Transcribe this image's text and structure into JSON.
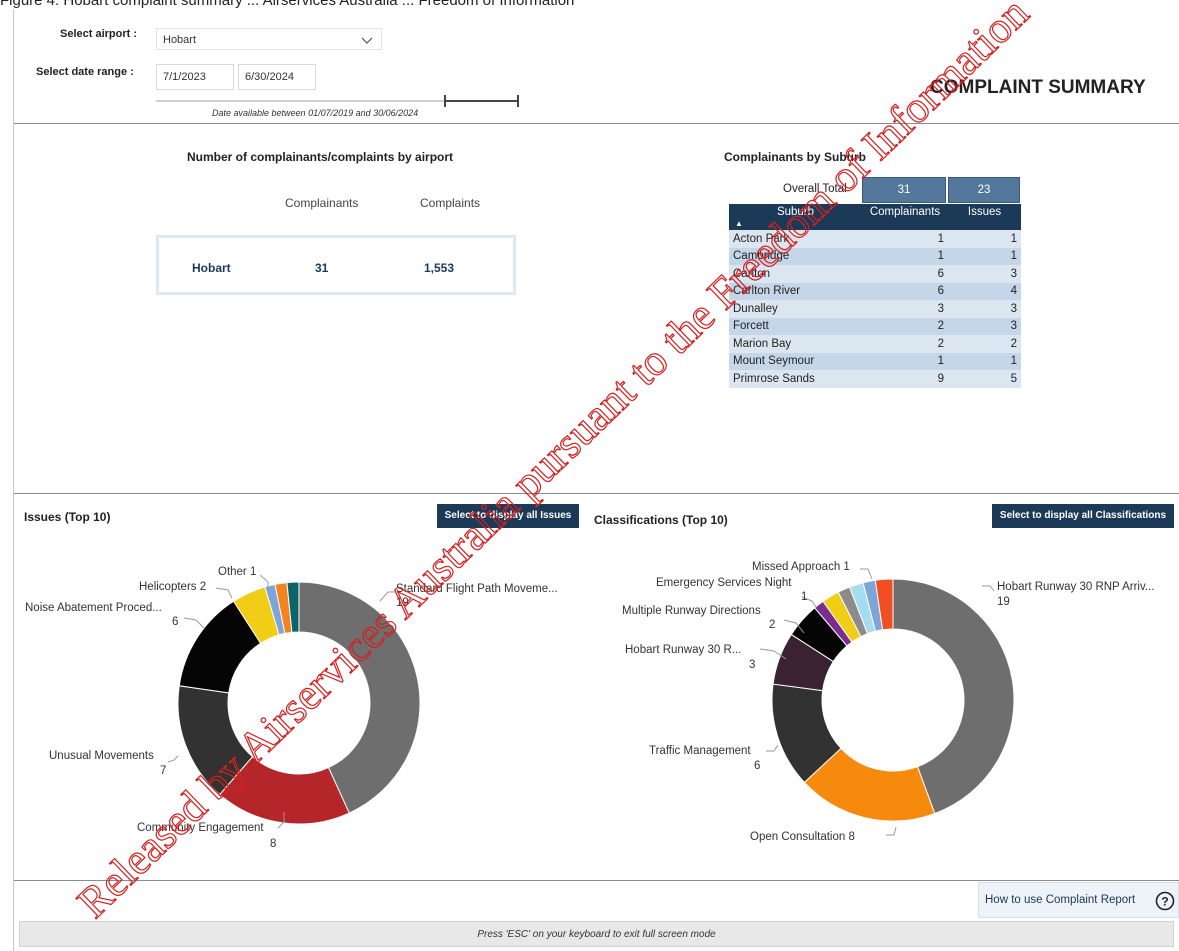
{
  "page_caption": "Figure 4: Hobart complaint summary ... Airservices Australia ... Freedom of Information",
  "filters": {
    "airport_label": "Select airport :",
    "airport_value": "Hobart",
    "date_label": "Select date range :",
    "date_start": "7/1/2023",
    "date_end": "6/30/2024",
    "date_note": "Date available between 01/07/2019 and 30/06/2024"
  },
  "report_title": "COMPLAINT SUMMARY",
  "by_airport": {
    "title": "Number of complainants/complaints by airport",
    "headers": [
      "Complainants",
      "Complaints"
    ],
    "rows": [
      {
        "airport": "Hobart",
        "complainants": "31",
        "complaints": "1,553"
      }
    ]
  },
  "by_suburb": {
    "title": "Complainants by Suburb",
    "overall_label": "Overall Total",
    "overall_complainants": "31",
    "overall_issues": "23",
    "headers": [
      "Suburb",
      "Complainants",
      "Issues"
    ],
    "rows": [
      {
        "suburb": "Acton Park",
        "complainants": "1",
        "issues": "1"
      },
      {
        "suburb": "Cambridge",
        "complainants": "1",
        "issues": "1"
      },
      {
        "suburb": "Carlton",
        "complainants": "6",
        "issues": "3"
      },
      {
        "suburb": "Carlton River",
        "complainants": "6",
        "issues": "4"
      },
      {
        "suburb": "Dunalley",
        "complainants": "3",
        "issues": "3"
      },
      {
        "suburb": "Forcett",
        "complainants": "2",
        "issues": "3"
      },
      {
        "suburb": "Marion Bay",
        "complainants": "2",
        "issues": "2"
      },
      {
        "suburb": "Mount Seymour",
        "complainants": "1",
        "issues": "1"
      },
      {
        "suburb": "Primrose Sands",
        "complainants": "9",
        "issues": "5"
      }
    ]
  },
  "issues_panel": {
    "title": "Issues (Top 10)",
    "button": "Select to display all Issues"
  },
  "class_panel": {
    "title": "Classifications (Top 10)",
    "button": "Select to display all Classifications"
  },
  "chart_data": [
    {
      "type": "pie",
      "title": "Issues (Top 10)",
      "slices": [
        {
          "label": "Standard Flight Path Moveme...",
          "value": 19,
          "color": "#6e6e6e"
        },
        {
          "label": "Community Engagement",
          "value": 8,
          "color": "#b5262b"
        },
        {
          "label": "Unusual Movements",
          "value": 7,
          "color": "#323232"
        },
        {
          "label": "Noise Abatement Proced...",
          "value": 6,
          "color": "#050505"
        },
        {
          "label": "Helicopters 2",
          "value": 2,
          "color": "#f2cd17"
        },
        {
          "label": "",
          "value": 0.6,
          "color": "#7ea5d8"
        },
        {
          "label": "Other 1",
          "value": 0.7,
          "color": "#f58220"
        },
        {
          "label": "",
          "value": 0.7,
          "color": "#0d6468"
        }
      ]
    },
    {
      "type": "pie",
      "title": "Classifications (Top 10)",
      "slices": [
        {
          "label": "Hobart Runway 30 RNP Arriv...",
          "value": 19,
          "color": "#6e6e6e"
        },
        {
          "label": "Open Consultation 8",
          "value": 8,
          "color": "#f58a0c"
        },
        {
          "label": "Traffic Management",
          "value": 6,
          "color": "#323232"
        },
        {
          "label": "Hobart Runway 30 R...",
          "value": 3,
          "color": "#3a2232"
        },
        {
          "label": "Multiple Runway Directions",
          "value": 2,
          "color": "#050505"
        },
        {
          "label": "",
          "value": 0.6,
          "color": "#7a2d8c"
        },
        {
          "label": "Emergency Services Night",
          "value": 1,
          "color": "#f2cd17"
        },
        {
          "label": "",
          "value": 0.7,
          "color": "#8c8c8c"
        },
        {
          "label": "",
          "value": 0.8,
          "color": "#a6dcef"
        },
        {
          "label": "",
          "value": 0.7,
          "color": "#7ea5d8"
        },
        {
          "label": "Missed Approach 1",
          "value": 1,
          "color": "#f04e23"
        }
      ]
    }
  ],
  "issues_labels": {
    "standard_name": "Standard Flight Path Moveme...",
    "standard_val": "19",
    "other": "Other 1",
    "helicopters": "Helicopters 2",
    "noise_name": "Noise Abatement Proced...",
    "noise_val": "6",
    "unusual_name": "Unusual Movements",
    "unusual_val": "7",
    "community_name": "Community Engagement",
    "community_val": "8"
  },
  "class_labels": {
    "missed": "Missed Approach 1",
    "emergency_name": "Emergency Services Night",
    "emergency_val": "1",
    "multiple_name": "Multiple Runway Directions",
    "multiple_val": "2",
    "hobartr_name": "Hobart Runway 30 R...",
    "hobartr_val": "3",
    "traffic_name": "Traffic Management",
    "traffic_val": "6",
    "open": "Open Consultation 8",
    "rnp_name": "Hobart Runway 30 RNP Arriv...",
    "rnp_val": "19"
  },
  "help_link": "How to use Complaint Report",
  "footer_hint": "Press 'ESC' on your keyboard to exit full screen mode",
  "watermark": "Released by Airservices Australia pursuant to the Freedom of Information",
  "watermark_color": "#d42020"
}
